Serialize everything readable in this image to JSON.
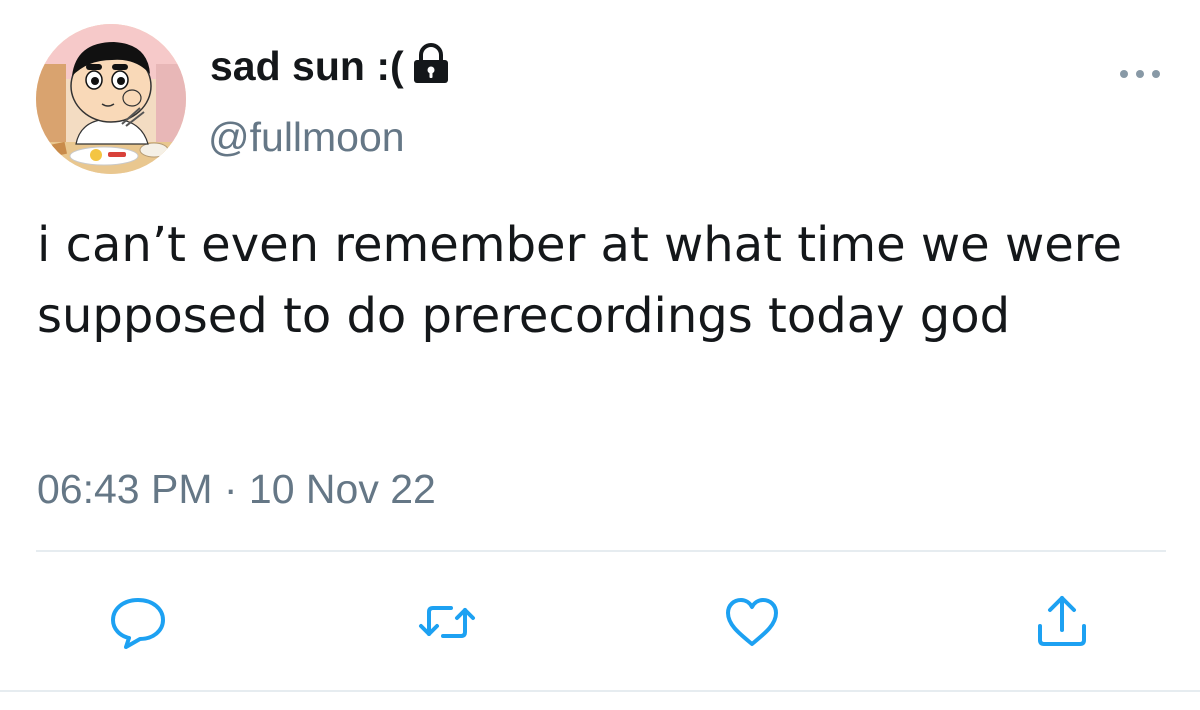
{
  "tweet": {
    "author": {
      "display_name": "sad sun :(",
      "username": "@fullmoon",
      "protected_icon": "lock-icon",
      "avatar": "cartoon-boy-eating-avatar"
    },
    "text": "i can’t even remember at what time we were supposed to do prerecordings today god",
    "timestamp": "06:43 PM · 10 Nov 22",
    "menu_icon": "more-horizontal-icon",
    "actions": [
      {
        "name": "reply",
        "icon": "speech-bubble-icon"
      },
      {
        "name": "retweet",
        "icon": "retweet-arrows-icon"
      },
      {
        "name": "like",
        "icon": "heart-icon"
      },
      {
        "name": "share",
        "icon": "share-upload-icon"
      }
    ]
  },
  "colors": {
    "text_primary": "#14171a",
    "text_secondary": "#657786",
    "icon_accent": "#1da1f2",
    "divider": "#e6ecf0"
  }
}
